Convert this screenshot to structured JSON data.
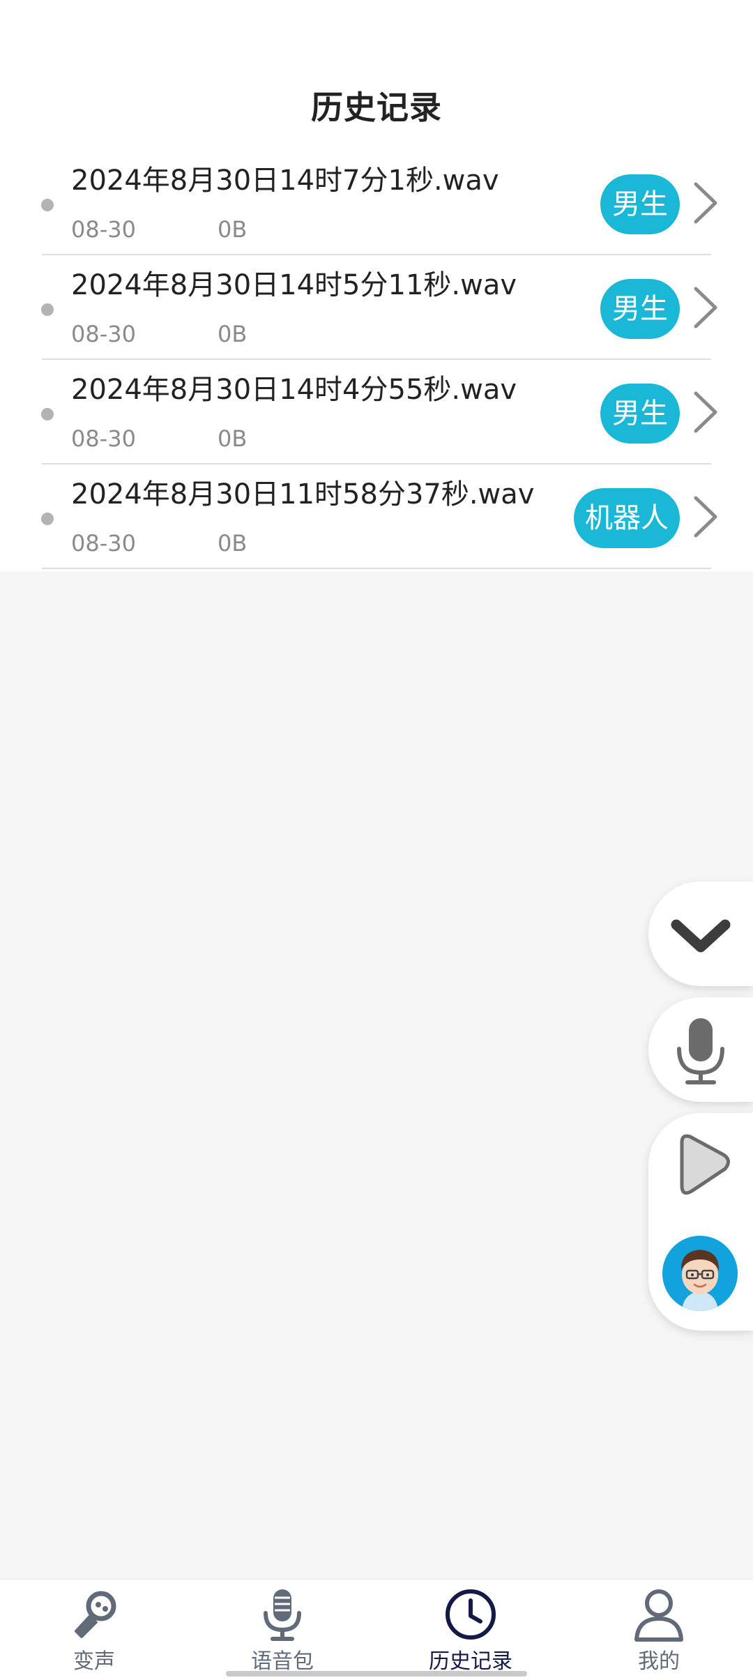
{
  "page_title": "历史记录",
  "records": [
    {
      "filename": "2024年8月30日14时7分1秒.wav",
      "date": "08-30",
      "size": "0B",
      "voice": "男生"
    },
    {
      "filename": "2024年8月30日14时5分11秒.wav",
      "date": "08-30",
      "size": "0B",
      "voice": "男生"
    },
    {
      "filename": "2024年8月30日14时4分55秒.wav",
      "date": "08-30",
      "size": "0B",
      "voice": "男生"
    },
    {
      "filename": "2024年8月30日11时58分37秒.wav",
      "date": "08-30",
      "size": "0B",
      "voice": "机器人"
    }
  ],
  "floating_controls": {
    "collapse_icon": "chevron-down-icon",
    "mic_icon": "microphone-icon",
    "play_icon": "play-icon",
    "avatar_icon": "avatar-boy-icon"
  },
  "bottom_nav": {
    "items": [
      {
        "label": "变声",
        "icon": "voice-changer-mic-icon",
        "active": false
      },
      {
        "label": "语音包",
        "icon": "microphone-icon",
        "active": false
      },
      {
        "label": "历史记录",
        "icon": "clock-icon",
        "active": true
      },
      {
        "label": "我的",
        "icon": "user-icon",
        "active": false
      }
    ]
  },
  "colors": {
    "accent": "#1ab7d6",
    "nav_active": "#141a45",
    "nav_inactive": "#616a78",
    "background": "#f5f5f5"
  }
}
